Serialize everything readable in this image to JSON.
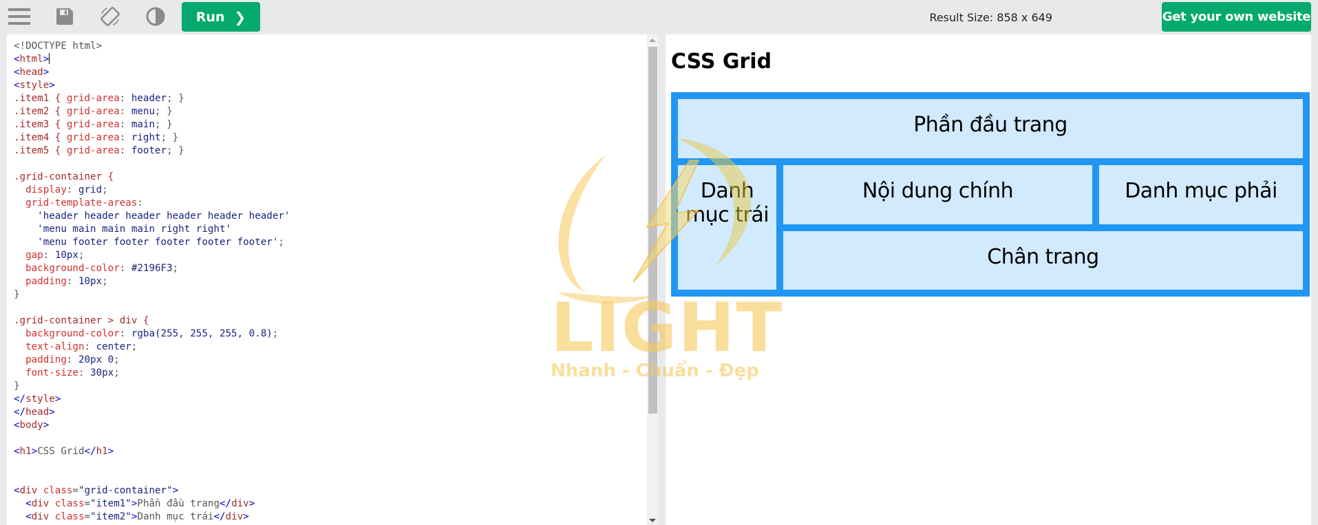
{
  "toolbar": {
    "icons": [
      "menu-icon",
      "save-icon",
      "rotate-icon",
      "theme-contrast-icon"
    ],
    "run_label": "Run",
    "run_chevron": "❯",
    "result_size": "Result Size: 858 x 649",
    "own_website_label": "Get your own website"
  },
  "code_editor": {
    "lines": [
      [
        [
          "cm",
          "<!DOCTYPE html>"
        ]
      ],
      [
        [
          "br",
          "<"
        ],
        [
          "tg",
          "html"
        ],
        [
          "br",
          ">"
        ],
        [
          "cursor",
          ""
        ]
      ],
      [
        [
          "br",
          "<"
        ],
        [
          "tg",
          "head"
        ],
        [
          "br",
          ">"
        ]
      ],
      [
        [
          "br",
          "<"
        ],
        [
          "tg",
          "style"
        ],
        [
          "br",
          ">"
        ]
      ],
      [
        [
          "sel",
          ".item1 { "
        ],
        [
          "pr",
          "grid-area"
        ],
        [
          "cm",
          ": "
        ],
        [
          "vl",
          "header"
        ],
        [
          "cm",
          "; }"
        ]
      ],
      [
        [
          "sel",
          ".item2 { "
        ],
        [
          "pr",
          "grid-area"
        ],
        [
          "cm",
          ": "
        ],
        [
          "vl",
          "menu"
        ],
        [
          "cm",
          "; }"
        ]
      ],
      [
        [
          "sel",
          ".item3 { "
        ],
        [
          "pr",
          "grid-area"
        ],
        [
          "cm",
          ": "
        ],
        [
          "vl",
          "main"
        ],
        [
          "cm",
          "; }"
        ]
      ],
      [
        [
          "sel",
          ".item4 { "
        ],
        [
          "pr",
          "grid-area"
        ],
        [
          "cm",
          ": "
        ],
        [
          "vl",
          "right"
        ],
        [
          "cm",
          "; }"
        ]
      ],
      [
        [
          "sel",
          ".item5 { "
        ],
        [
          "pr",
          "grid-area"
        ],
        [
          "cm",
          ": "
        ],
        [
          "vl",
          "footer"
        ],
        [
          "cm",
          "; }"
        ]
      ],
      [
        [
          "cm",
          ""
        ]
      ],
      [
        [
          "sel",
          ".grid-container {"
        ]
      ],
      [
        [
          "pr",
          "  display"
        ],
        [
          "cm",
          ": "
        ],
        [
          "vl",
          "grid"
        ],
        [
          "cm",
          ";"
        ]
      ],
      [
        [
          "pr",
          "  grid-template-areas"
        ],
        [
          "cm",
          ":"
        ]
      ],
      [
        [
          "vl",
          "    'header header header header header header'"
        ]
      ],
      [
        [
          "vl",
          "    'menu main main main right right'"
        ]
      ],
      [
        [
          "vl",
          "    'menu footer footer footer footer footer'"
        ],
        [
          "cm",
          ";"
        ]
      ],
      [
        [
          "pr",
          "  gap"
        ],
        [
          "cm",
          ": "
        ],
        [
          "vl",
          "10px"
        ],
        [
          "cm",
          ";"
        ]
      ],
      [
        [
          "pr",
          "  background-color"
        ],
        [
          "cm",
          ": "
        ],
        [
          "vl",
          "#2196F3"
        ],
        [
          "cm",
          ";"
        ]
      ],
      [
        [
          "pr",
          "  padding"
        ],
        [
          "cm",
          ": "
        ],
        [
          "vl",
          "10px"
        ],
        [
          "cm",
          ";"
        ]
      ],
      [
        [
          "cm",
          "}"
        ]
      ],
      [
        [
          "cm",
          ""
        ]
      ],
      [
        [
          "sel",
          ".grid-container > div {"
        ]
      ],
      [
        [
          "pr",
          "  background-color"
        ],
        [
          "cm",
          ": "
        ],
        [
          "vl",
          "rgba(255, 255, 255, 0.8)"
        ],
        [
          "cm",
          ";"
        ]
      ],
      [
        [
          "pr",
          "  text-align"
        ],
        [
          "cm",
          ": "
        ],
        [
          "vl",
          "center"
        ],
        [
          "cm",
          ";"
        ]
      ],
      [
        [
          "pr",
          "  padding"
        ],
        [
          "cm",
          ": "
        ],
        [
          "vl",
          "20px 0"
        ],
        [
          "cm",
          ";"
        ]
      ],
      [
        [
          "pr",
          "  font-size"
        ],
        [
          "cm",
          ": "
        ],
        [
          "vl",
          "30px"
        ],
        [
          "cm",
          ";"
        ]
      ],
      [
        [
          "cm",
          "}"
        ]
      ],
      [
        [
          "br",
          "</"
        ],
        [
          "tg",
          "style"
        ],
        [
          "br",
          ">"
        ]
      ],
      [
        [
          "br",
          "</"
        ],
        [
          "tg",
          "head"
        ],
        [
          "br",
          ">"
        ]
      ],
      [
        [
          "br",
          "<"
        ],
        [
          "tg",
          "body"
        ],
        [
          "br",
          ">"
        ]
      ],
      [
        [
          "cm",
          ""
        ]
      ],
      [
        [
          "br",
          "<"
        ],
        [
          "tg",
          "h1"
        ],
        [
          "br",
          ">"
        ],
        [
          "cm",
          "CSS Grid"
        ],
        [
          "br",
          "</"
        ],
        [
          "tg",
          "h1"
        ],
        [
          "br",
          ">"
        ]
      ],
      [
        [
          "cm",
          ""
        ]
      ],
      [
        [
          "cm",
          ""
        ]
      ],
      [
        [
          "br",
          "<"
        ],
        [
          "tg",
          "div"
        ],
        [
          "at",
          " class"
        ],
        [
          "cm",
          "="
        ],
        [
          "sv",
          "\"grid-container\""
        ],
        [
          "br",
          ">"
        ]
      ],
      [
        [
          "cm",
          "  "
        ],
        [
          "br",
          "<"
        ],
        [
          "tg",
          "div"
        ],
        [
          "at",
          " class"
        ],
        [
          "cm",
          "="
        ],
        [
          "sv",
          "\"item1\""
        ],
        [
          "br",
          ">"
        ],
        [
          "cm",
          "Phần đầu trang"
        ],
        [
          "br",
          "</"
        ],
        [
          "tg",
          "div"
        ],
        [
          "br",
          ">"
        ]
      ],
      [
        [
          "cm",
          "  "
        ],
        [
          "br",
          "<"
        ],
        [
          "tg",
          "div"
        ],
        [
          "at",
          " class"
        ],
        [
          "cm",
          "="
        ],
        [
          "sv",
          "\"item2\""
        ],
        [
          "br",
          ">"
        ],
        [
          "cm",
          "Danh mục trái"
        ],
        [
          "br",
          "</"
        ],
        [
          "tg",
          "div"
        ],
        [
          "br",
          ">"
        ]
      ]
    ]
  },
  "result": {
    "heading": "CSS Grid",
    "grid_color": "#2196F3",
    "items": {
      "header": "Phần đầu trang",
      "menu": "Danh mục trái",
      "main": "Nội dung chính",
      "right": "Danh mục phải",
      "footer": "Chân trang"
    }
  },
  "watermark": {
    "brand": "LIGHT",
    "slogan": "Nhanh - Chuẩn - Đẹp"
  },
  "colors": {
    "accent": "#04AA6D",
    "toolbar_bg": "#E7E9EB",
    "grid_blue": "#2196F3"
  }
}
